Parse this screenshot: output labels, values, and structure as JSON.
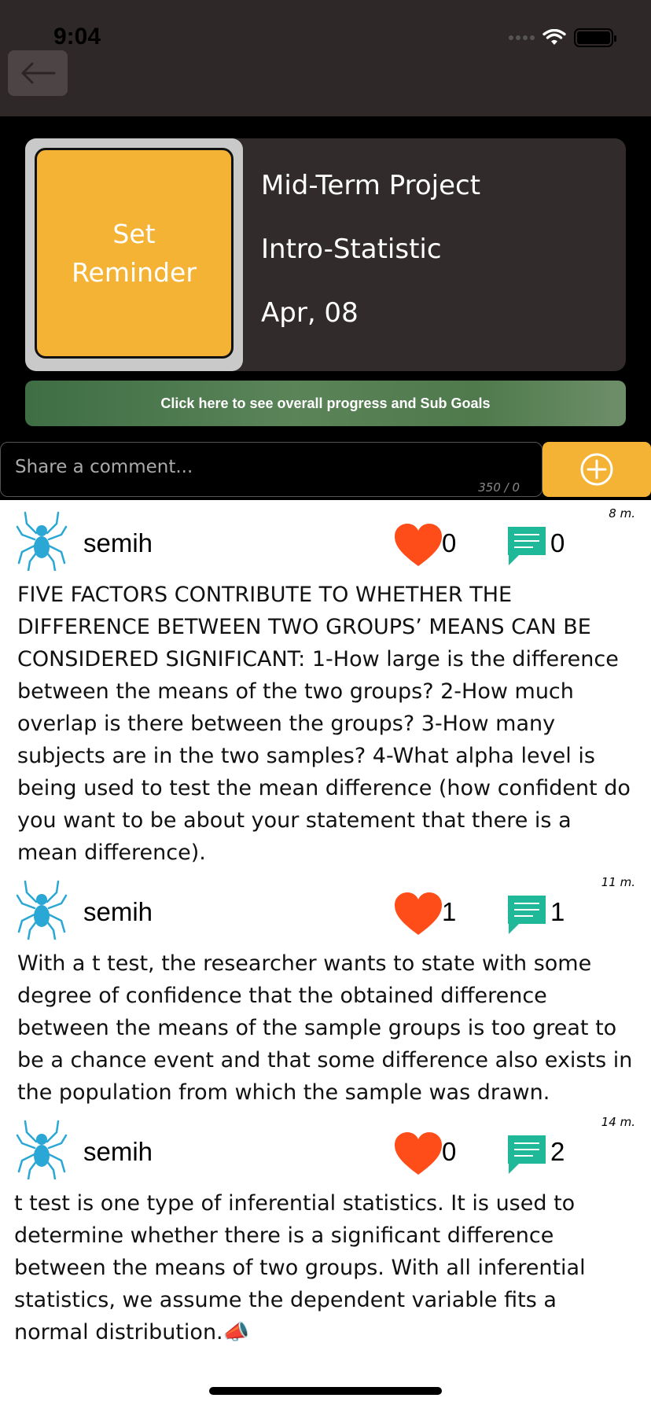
{
  "status_bar": {
    "time": "9:04"
  },
  "header": {
    "reminder_button": "Set\nReminder",
    "goal_title": "Mid-Term Project",
    "course": "Intro-Statistic",
    "date": "Apr, 08",
    "progress_link": "Click here to see overall progress and Sub Goals"
  },
  "comment_box": {
    "placeholder": "Share a comment...",
    "char_count": "350 / 0"
  },
  "posts": [
    {
      "username": "semih",
      "likes": "0",
      "comments": "0",
      "time": "8 m.",
      "text": "FIVE FACTORS CONTRIBUTE TO WHETHER THE DIFFERENCE BETWEEN TWO GROUPS’ MEANS CAN BE CONSIDERED SIGNIFICANT: 1-How large is the difference between the means of the two groups?  2-How much overlap is there between the groups? 3-How many subjects are in the two samples? 4-What alpha level is being used to test the mean difference (how confident do you want to be about your statement that there is a mean difference)."
    },
    {
      "username": "semih",
      "likes": "1",
      "comments": "1",
      "time": "11 m.",
      "text": "With a t test, the researcher wants to state with some degree of confidence that the obtained difference between the means of the sample groups is too great to be a chance event and that some difference also exists in the population from which the sample was drawn."
    },
    {
      "username": "semih",
      "likes": "0",
      "comments": "2",
      "time": "14 m.",
      "text": "t test is one type of inferential statistics. It is used to determine whether there is a significant difference between the means of two groups. With all inferential statistics, we assume the dependent variable fits a normal distribution.📣"
    }
  ],
  "colors": {
    "accent_yellow": "#f4b335",
    "heart_red": "#ff4d1a",
    "comment_teal": "#1fb99a",
    "avatar_blue": "#2aa7d4"
  }
}
